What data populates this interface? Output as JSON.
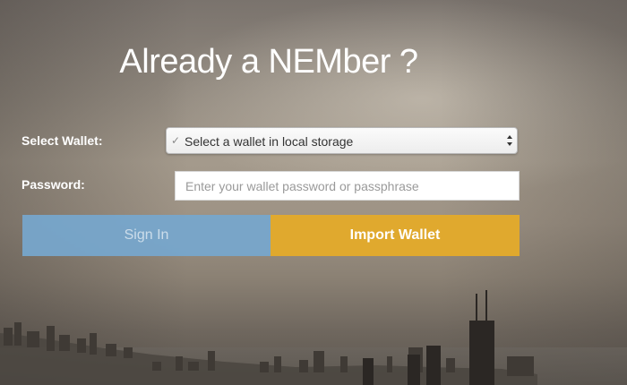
{
  "page": {
    "title": "Already a NEMber ?"
  },
  "form": {
    "wallet_label": "Select Wallet:",
    "wallet_select": {
      "selected_text": "Select a wallet in local storage"
    },
    "password_label": "Password:",
    "password_input": {
      "value": "",
      "placeholder": "Enter your wallet password or passphrase"
    }
  },
  "buttons": {
    "sign_in": "Sign In",
    "import_wallet": "Import Wallet"
  },
  "colors": {
    "sign_in_button": "#76a7ce",
    "import_wallet_button": "#e0a92e",
    "text": "#ffffff"
  }
}
